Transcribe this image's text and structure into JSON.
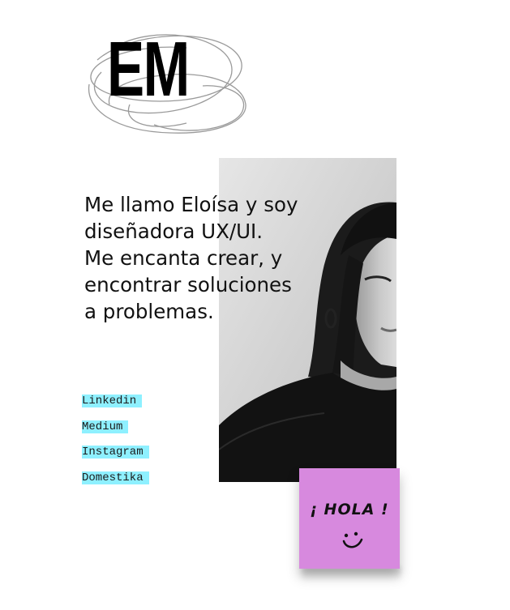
{
  "logo": {
    "initials": "EM"
  },
  "intro": {
    "lines": [
      "Me llamo Eloísa y soy",
      "diseñadora UX/UI.",
      "Me encanta crear, y",
      "encontrar soluciones",
      "a problemas."
    ]
  },
  "links": [
    {
      "label": "Linkedin"
    },
    {
      "label": "Medium"
    },
    {
      "label": "Instagram"
    },
    {
      "label": "Domestika"
    }
  ],
  "note": {
    "text": "¡ HOLA !",
    "face": ":)"
  },
  "colors": {
    "link_highlight": "#8ef0ff",
    "sticky_note": "#d789de",
    "text": "#111111"
  }
}
